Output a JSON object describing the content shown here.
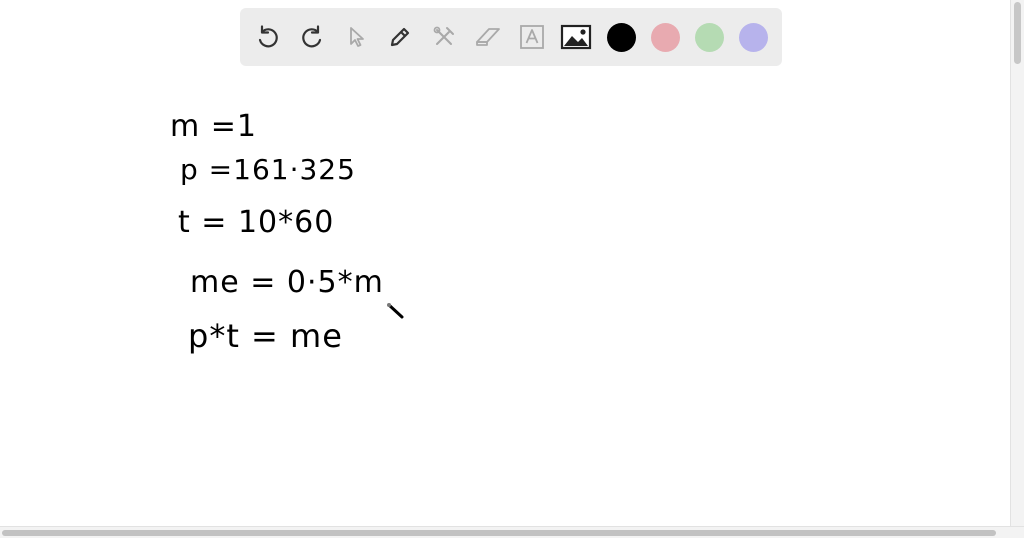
{
  "toolbar": {
    "tools": [
      {
        "name": "undo-icon"
      },
      {
        "name": "redo-icon"
      },
      {
        "name": "select-pointer-icon"
      },
      {
        "name": "pen-icon"
      },
      {
        "name": "tools-icon"
      },
      {
        "name": "eraser-icon"
      },
      {
        "name": "text-box-icon"
      },
      {
        "name": "image-icon"
      }
    ],
    "colors": [
      "#000000",
      "#e8aab0",
      "#b5dbb3",
      "#b7b3ec"
    ]
  },
  "canvas": {
    "lines": [
      "m =1",
      "p =161·325",
      "t = 10*60",
      "me = 0·5*m",
      "p*t = me"
    ]
  }
}
